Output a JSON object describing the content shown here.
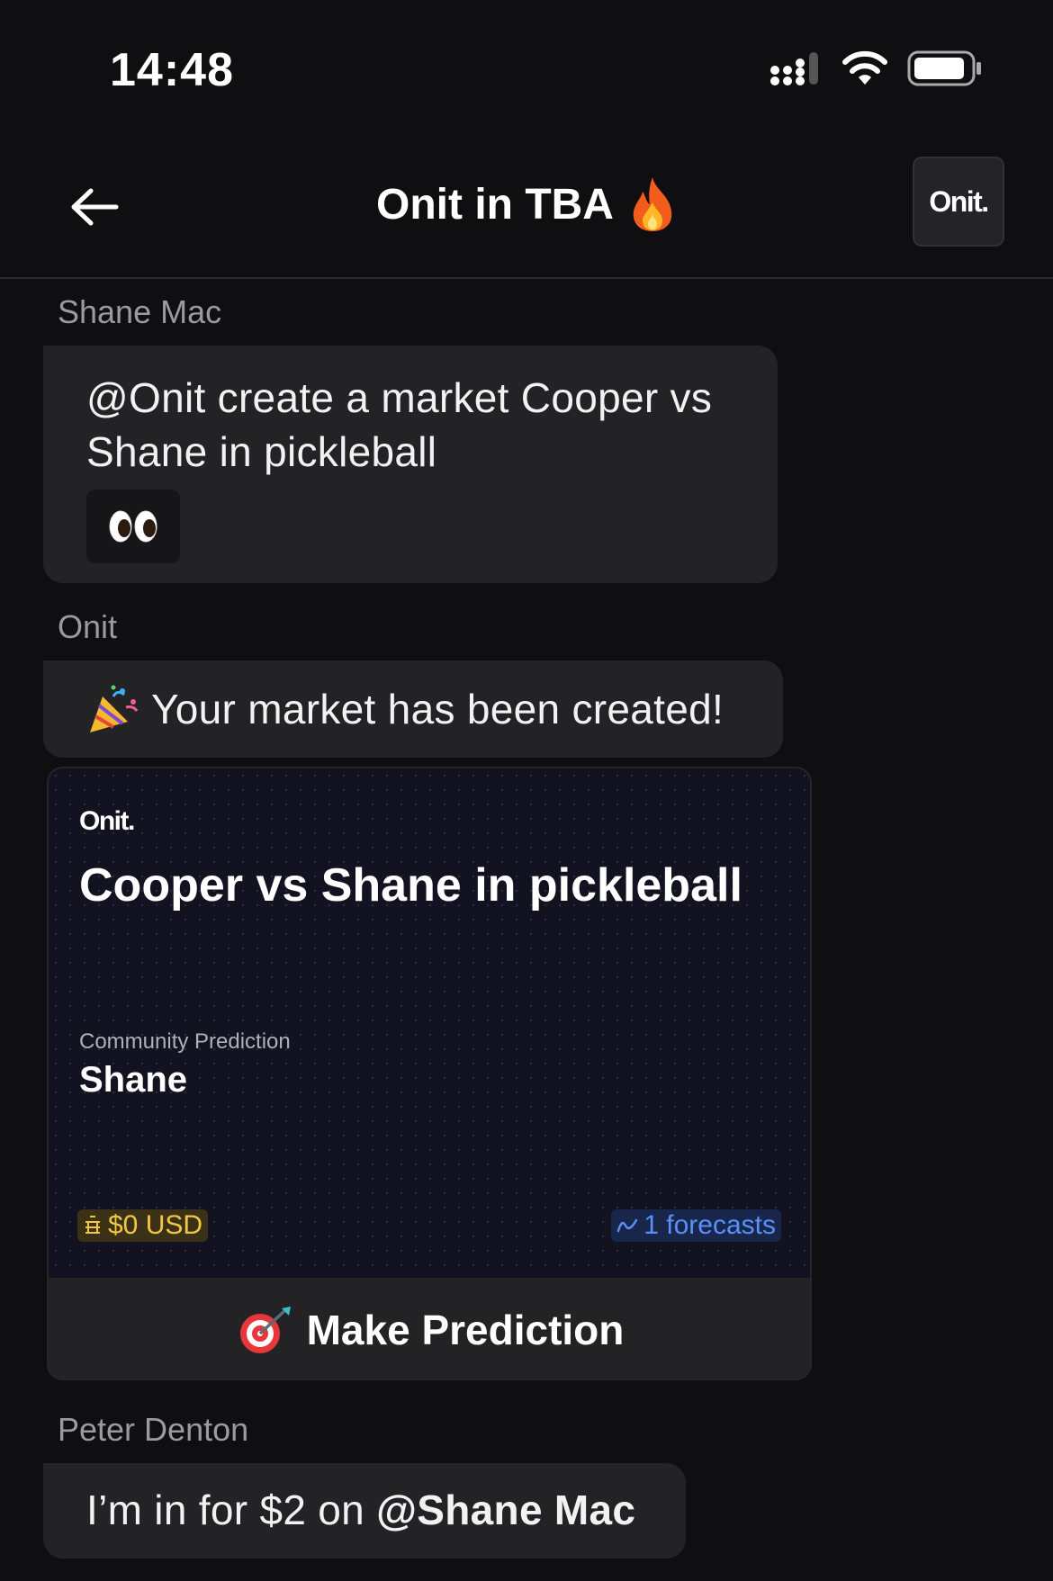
{
  "status_bar": {
    "time": "14:48"
  },
  "header": {
    "title": "Onit in TBA",
    "logo_label": "Onit."
  },
  "messages": [
    {
      "sender": "Shane Mac",
      "text": "@Onit create a market Cooper vs Shane in pickleball",
      "reaction": "eyes-emoji"
    },
    {
      "sender": "Onit",
      "text": "Your market has been created!",
      "icon": "party-popper-icon"
    },
    {
      "sender": "Peter Denton",
      "text_prefix": "I’m in for $2 on ",
      "mention": "@Shane Mac"
    }
  ],
  "market_card": {
    "brand": "Onit.",
    "title": "Cooper vs Shane in pickleball",
    "community_label": "Community Prediction",
    "community_value": "Shane",
    "volume": "$0 USD",
    "forecasts": "1 forecasts",
    "button_label": "Make Prediction"
  },
  "colors": {
    "background": "#0f0f11",
    "bubble": "#232326",
    "card": "#121220",
    "volume_accent": "#f2c744",
    "forecast_accent": "#5b8ff9"
  }
}
